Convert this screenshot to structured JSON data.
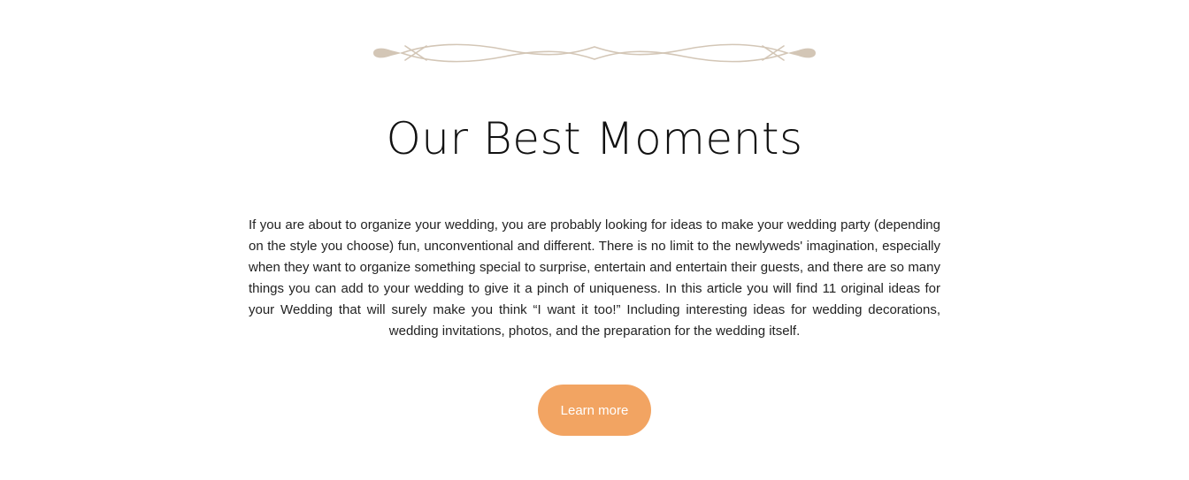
{
  "section": {
    "ornament_icon": "scroll-divider-icon",
    "ornament_color": "#d3c6b6",
    "title": "Our Best Moments",
    "body": "If you are about to organize your wedding, you are probably looking for ideas to make your wedding party (depending on the style you choose) fun, unconventional and different. There is no limit to the newlyweds' imagination, especially when they want to organize something special to surprise, entertain and entertain their guests, and there are so many things you can add to your wedding to give it a pinch of uniqueness. In this article you will find 11 original ideas for your Wedding that will surely make you think “I want it too!” Including interesting ideas for wedding decorations, wedding invitations, photos, and the preparation for the wedding itself.",
    "button_label": "Learn more",
    "button_color": "#f2a462"
  }
}
